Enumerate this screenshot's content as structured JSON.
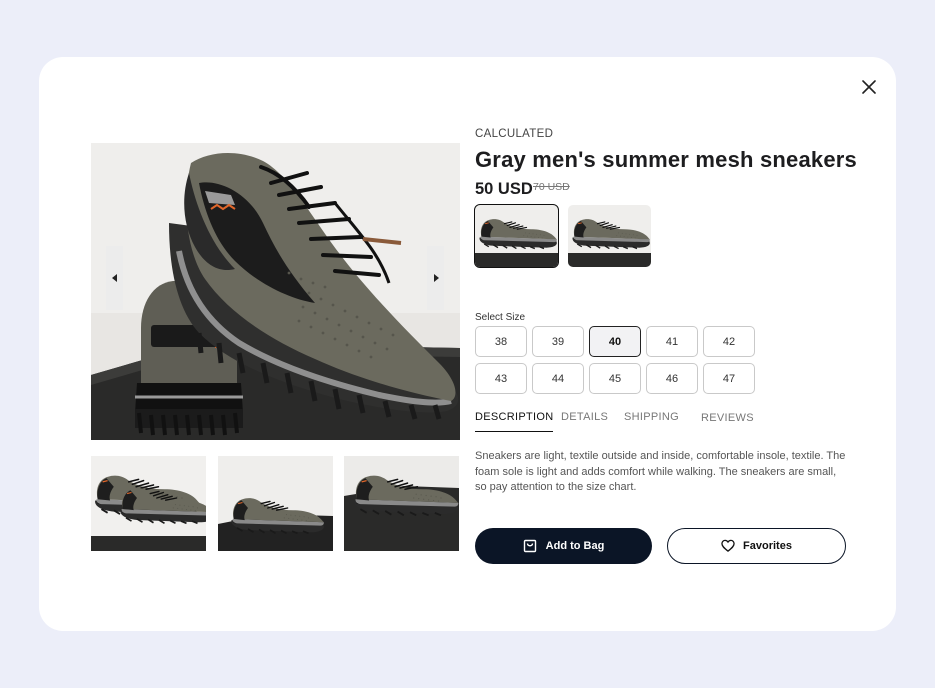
{
  "product": {
    "brand": "CALCULATED",
    "title": "Gray men's summer mesh sneakers",
    "price": "50 USD",
    "old_price": "70 USD"
  },
  "sizes": {
    "label": "Select Size",
    "options": [
      "38",
      "39",
      "40",
      "41",
      "42",
      "43",
      "44",
      "45",
      "46",
      "47"
    ],
    "selected": "40"
  },
  "tabs": [
    "DESCRIPTION",
    "DETAILS",
    "SHIPPING",
    "REVIEWS"
  ],
  "active_tab": "DESCRIPTION",
  "description": "Sneakers are light, textile outside and inside, comfortable insole, textile. The foam sole is light and adds comfort while walking. The sneakers are small, so pay attention to the size chart.",
  "actions": {
    "add_to_bag": "Add to Bag",
    "favorites": "Favorites"
  },
  "logo_text": "CALCULATED",
  "icons": {
    "close": "close-icon",
    "prev": "arrow-left-icon",
    "next": "arrow-right-icon",
    "bag": "shopping-bag-icon",
    "heart": "heart-icon"
  },
  "colors": {
    "page_bg": "#eceef9",
    "modal_bg": "#ffffff",
    "primary_button": "#0b1526",
    "shoe_mesh": "#6b6a5e",
    "accent_orange": "#e0662a"
  }
}
